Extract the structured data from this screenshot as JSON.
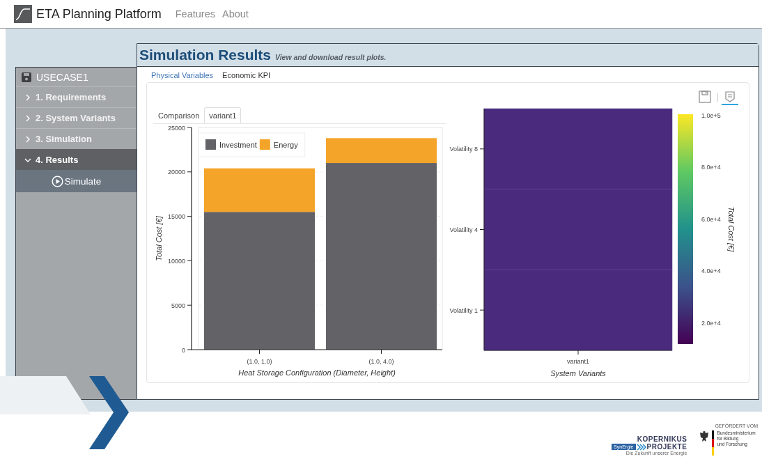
{
  "navbar": {
    "title": "ETA Planning Platform",
    "links": [
      {
        "label": "Features"
      },
      {
        "label": "About"
      }
    ]
  },
  "sidebar": {
    "project": "USECASE1",
    "steps": [
      {
        "label": "1. Requirements",
        "selected": false,
        "expanded": false
      },
      {
        "label": "2. System Variants",
        "selected": false,
        "expanded": false
      },
      {
        "label": "3. Simulation",
        "selected": false,
        "expanded": false
      },
      {
        "label": "4. Results",
        "selected": true,
        "expanded": true,
        "children": [
          {
            "label": "Simulate"
          }
        ]
      }
    ]
  },
  "page": {
    "title": "Simulation Results",
    "subtitle": "View and download result plots."
  },
  "tabs": [
    {
      "label": "Physical Variables",
      "selected": false
    },
    {
      "label": "Economic KPI",
      "selected": true
    }
  ],
  "toolbar": [
    {
      "kind": "save",
      "selected": false
    },
    {
      "kind": "comment",
      "selected": true
    }
  ],
  "plot_tabs": [
    {
      "label": "Comparison",
      "selected": false
    },
    {
      "label": "variant1",
      "selected": true
    }
  ],
  "bar_chart": {
    "chart_data": {
      "type": "bar",
      "stacked": true,
      "xlabel": "Heat Storage Configuration (Diameter, Height)",
      "ylabel": "Total Cost [€]",
      "categories": [
        "(1.0, 1.0)",
        "(1.0, 4.0)"
      ],
      "series": [
        {
          "name": "Investment",
          "color": "#636367",
          "values": [
            15500,
            21000
          ]
        },
        {
          "name": "Energy",
          "color": "#f5a42a",
          "values": [
            4900,
            2800
          ]
        }
      ],
      "ylim": [
        0,
        25000
      ],
      "yticks": [
        0,
        5000,
        10000,
        15000,
        20000,
        25000
      ],
      "grid": true,
      "legend": true
    }
  },
  "heatmap": {
    "xlabel": "System Variants",
    "x_categories": [
      "variant1"
    ],
    "y_categories": [
      "Volatility 8",
      "Volatility 4",
      "Volatility 1"
    ],
    "colorbar": {
      "title": "Total Cost [€]",
      "ticks": [
        "1.0e+5",
        "8.0e+4",
        "6.0e+4",
        "4.0e+4",
        "2.0e+4"
      ]
    }
  },
  "footer": {
    "kopernikus": {
      "title": "KOPERNIKUS",
      "badge": "SynErgie",
      "subtitle": "PROJEKTE",
      "tagline": "Die Zukunft unserer Energie"
    },
    "sponsor": {
      "caption": "GEFÖRDERT VOM",
      "lines": [
        "Bundesministerium",
        "für Bildung",
        "und Forschung"
      ]
    }
  }
}
